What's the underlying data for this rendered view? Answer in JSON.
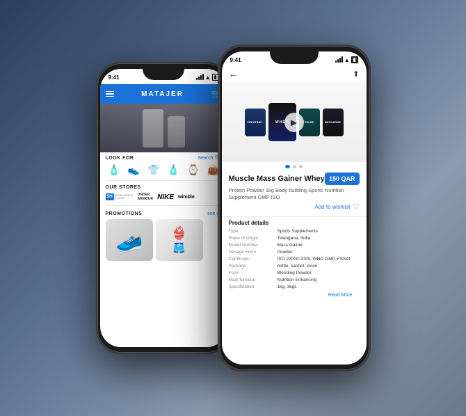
{
  "background": {
    "gradient": "135deg, #2c3e5a 0%, #5a7090 40%, #8a9ab0 70%, #6a7a8a 100%"
  },
  "left_phone": {
    "status_time": "9:41",
    "app_name": "MATAJER",
    "look_for_label": "LOOK FOR",
    "search_label": "Search",
    "our_stores_label": "OUR STORES",
    "promotions_label": "PROMOTIONS",
    "see_all_label": "see all",
    "categories": [
      "bottle",
      "shoe",
      "shirt",
      "perfume",
      "watch",
      "bag"
    ],
    "stores": [
      "SH",
      "UNDER ARMOUR",
      "NIKE",
      "wimble"
    ]
  },
  "right_phone": {
    "status_time": "9:41",
    "product_name": "Muscle Mass Gainer Whey",
    "price": "150 QAR",
    "description": "Protein Powder 1kg Body building Sports Nutrition Supplement GMP ISO",
    "add_to_wishlist": "Add to wishlist",
    "product_details_title": "Product details",
    "read_more": "Read More",
    "details": [
      {
        "key": "Type",
        "value": "Sports Supplements"
      },
      {
        "key": "Place of Origin",
        "value": "Telangana, India"
      },
      {
        "key": "Model Number",
        "value": "Mass Gainer"
      },
      {
        "key": "Dosage Form",
        "value": "Powder"
      },
      {
        "key": "Certificate",
        "value": "ISO 22000:2005, WHO GMP, FSSAI"
      },
      {
        "key": "Package",
        "value": "bottle, sachet, loose"
      },
      {
        "key": "Form",
        "value": "Blending Powder"
      },
      {
        "key": "Main function",
        "value": "Nutrition Enhancing"
      },
      {
        "key": "Specification",
        "value": "1kg, 3kgs"
      }
    ]
  }
}
